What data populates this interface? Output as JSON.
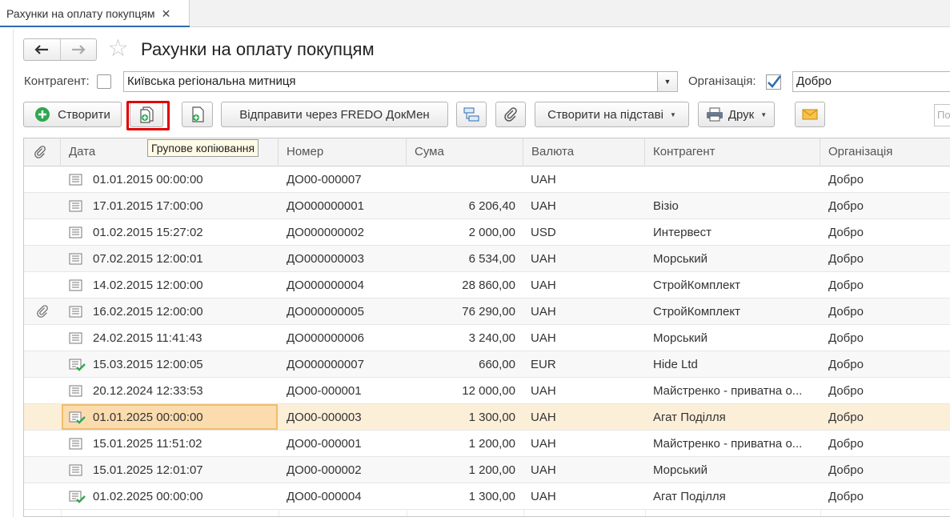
{
  "tab": {
    "title": "Рахунки на оплату покупцям",
    "close": "✕"
  },
  "page": {
    "title": "Рахунки на оплату покупцям"
  },
  "filters": {
    "kontragent_label": "Контрагент:",
    "kontragent_checked": false,
    "kontragent_value": "Київська регіональна митниця",
    "organizacia_label": "Організація:",
    "organizacia_checked": true,
    "organizacia_value": "Добро"
  },
  "toolbar": {
    "create_label": "Створити",
    "send_label": "Відправити через FREDO ДокМен",
    "create_based_label": "Створити на підставі",
    "print_label": "Друк",
    "search_placeholder": "По"
  },
  "tooltip": {
    "text": "Групове копіювання"
  },
  "table": {
    "headers": {
      "date": "Дата",
      "nomer": "Номер",
      "suma": "Сума",
      "valuta": "Валюта",
      "kontragent": "Контрагент",
      "organizacia": "Організація"
    },
    "rows": [
      {
        "date": "01.01.2015 00:00:00",
        "nomer": "ДО00-000007",
        "suma": "",
        "valuta": "UAH",
        "kontragent": "",
        "organizacia": "Добро",
        "posted": false,
        "attached": false
      },
      {
        "date": "17.01.2015 17:00:00",
        "nomer": "ДО000000001",
        "suma": "6 206,40",
        "valuta": "UAH",
        "kontragent": "Візіо",
        "organizacia": "Добро",
        "posted": false,
        "attached": false
      },
      {
        "date": "01.02.2015 15:27:02",
        "nomer": "ДО000000002",
        "suma": "2 000,00",
        "valuta": "USD",
        "kontragent": "Интервест",
        "organizacia": "Добро",
        "posted": false,
        "attached": false
      },
      {
        "date": "07.02.2015 12:00:01",
        "nomer": "ДО000000003",
        "suma": "6 534,00",
        "valuta": "UAH",
        "kontragent": "Морський",
        "organizacia": "Добро",
        "posted": false,
        "attached": false
      },
      {
        "date": "14.02.2015 12:00:00",
        "nomer": "ДО000000004",
        "suma": "28 860,00",
        "valuta": "UAH",
        "kontragent": "СтройКомплект",
        "organizacia": "Добро",
        "posted": false,
        "attached": false
      },
      {
        "date": "16.02.2015 12:00:00",
        "nomer": "ДО000000005",
        "suma": "76 290,00",
        "valuta": "UAH",
        "kontragent": "СтройКомплект",
        "organizacia": "Добро",
        "posted": false,
        "attached": true
      },
      {
        "date": "24.02.2015 11:41:43",
        "nomer": "ДО000000006",
        "suma": "3 240,00",
        "valuta": "UAH",
        "kontragent": "Морський",
        "organizacia": "Добро",
        "posted": false,
        "attached": false
      },
      {
        "date": "15.03.2015 12:00:05",
        "nomer": "ДО000000007",
        "suma": "660,00",
        "valuta": "EUR",
        "kontragent": "Hide Ltd",
        "organizacia": "Добро",
        "posted": true,
        "attached": false
      },
      {
        "date": "20.12.2024 12:33:53",
        "nomer": "ДО00-000001",
        "suma": "12 000,00",
        "valuta": "UAH",
        "kontragent": "Майстренко - приватна о...",
        "organizacia": "Добро",
        "posted": false,
        "attached": false
      },
      {
        "date": "01.01.2025 00:00:00",
        "nomer": "ДО00-000003",
        "suma": "1 300,00",
        "valuta": "UAH",
        "kontragent": "Агат Поділля",
        "organizacia": "Добро",
        "posted": true,
        "attached": false,
        "selected": true
      },
      {
        "date": "15.01.2025 11:51:02",
        "nomer": "ДО00-000001",
        "suma": "1 200,00",
        "valuta": "UAH",
        "kontragent": "Майстренко - приватна о...",
        "organizacia": "Добро",
        "posted": false,
        "attached": false
      },
      {
        "date": "15.01.2025 12:01:07",
        "nomer": "ДО00-000002",
        "suma": "1 200,00",
        "valuta": "UAH",
        "kontragent": "Морський",
        "organizacia": "Добро",
        "posted": false,
        "attached": false
      },
      {
        "date": "01.02.2025 00:00:00",
        "nomer": "ДО00-000004",
        "suma": "1 300,00",
        "valuta": "UAH",
        "kontragent": "Агат Поділля",
        "organizacia": "Добро",
        "posted": true,
        "attached": false
      }
    ]
  },
  "colors": {
    "accent": "#2e6bb2",
    "highlight_border": "#e00000",
    "selected_row": "#fcefd8",
    "selected_cell": "#fbdcae",
    "green": "#2fa84f"
  }
}
